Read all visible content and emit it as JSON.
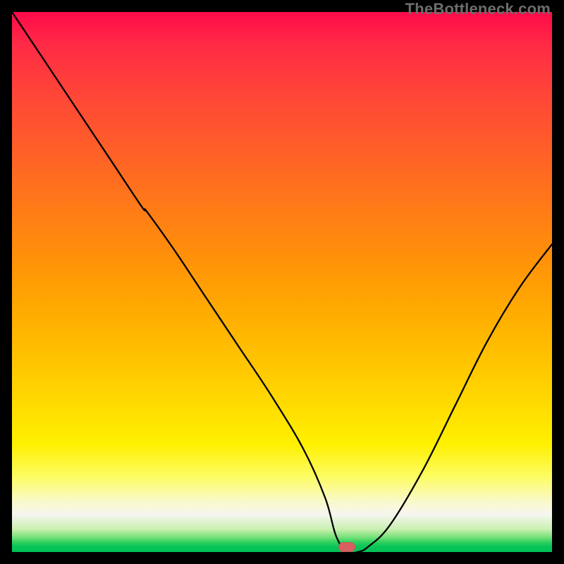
{
  "watermark": "TheBottleneck.com",
  "marker": {
    "x_pct": 62,
    "y_pct": 99.1
  },
  "chart_data": {
    "type": "line",
    "title": "",
    "xlabel": "",
    "ylabel": "",
    "xlim": [
      0,
      100
    ],
    "ylim": [
      0,
      100
    ],
    "series": [
      {
        "name": "bottleneck-curve",
        "x": [
          0,
          6,
          12,
          18,
          24,
          25,
          30,
          36,
          42,
          48,
          54,
          58,
          60,
          62,
          64,
          66,
          70,
          76,
          82,
          88,
          94,
          100
        ],
        "y": [
          100,
          91,
          82,
          73,
          64,
          63,
          56,
          47,
          38,
          29,
          19,
          10,
          3,
          0,
          0,
          1,
          5,
          15,
          27,
          39,
          49,
          57
        ]
      }
    ],
    "annotations": [],
    "grid": false,
    "legend": false
  }
}
